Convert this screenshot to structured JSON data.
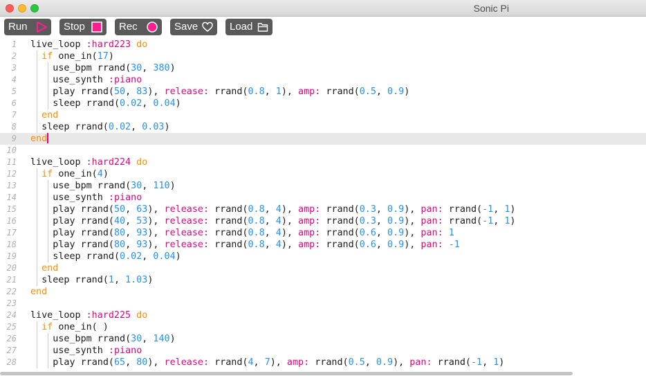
{
  "window": {
    "title": "Sonic Pi"
  },
  "toolbar": {
    "run_label": "Run",
    "stop_label": "Stop",
    "rec_label": "Rec",
    "save_label": "Save",
    "load_label": "Load",
    "icons": {
      "run": "play-triangle-icon",
      "stop": "stop-square-icon",
      "rec": "record-circle-icon",
      "save": "heart-icon",
      "load": "folder-icon"
    },
    "colors": {
      "button_bg": "#5a5a5a",
      "accent": "#ff1e8e"
    }
  },
  "editor": {
    "current_line": 9,
    "lines": [
      {
        "n": "1",
        "indent": 0,
        "tokens": [
          [
            "p",
            "live_loop "
          ],
          [
            "s",
            ":hard223"
          ],
          [
            "k",
            " do"
          ]
        ]
      },
      {
        "n": "2",
        "indent": 1,
        "tokens": [
          [
            "k",
            "if "
          ],
          [
            "p",
            "one_in("
          ],
          [
            "n",
            "17"
          ],
          [
            "p",
            ")"
          ]
        ]
      },
      {
        "n": "3",
        "indent": 2,
        "tokens": [
          [
            "p",
            "use_bpm rrand("
          ],
          [
            "n",
            "30"
          ],
          [
            "p",
            ", "
          ],
          [
            "n",
            "380"
          ],
          [
            "p",
            ")"
          ]
        ]
      },
      {
        "n": "4",
        "indent": 2,
        "tokens": [
          [
            "p",
            "use_synth "
          ],
          [
            "s",
            ":piano"
          ]
        ]
      },
      {
        "n": "5",
        "indent": 2,
        "tokens": [
          [
            "p",
            "play rrand("
          ],
          [
            "n",
            "50"
          ],
          [
            "p",
            ", "
          ],
          [
            "n",
            "83"
          ],
          [
            "p",
            "), "
          ],
          [
            "s",
            "release:"
          ],
          [
            "p",
            " rrand("
          ],
          [
            "n",
            "0.8"
          ],
          [
            "p",
            ", "
          ],
          [
            "n",
            "1"
          ],
          [
            "p",
            "), "
          ],
          [
            "s",
            "amp:"
          ],
          [
            "p",
            " rrand("
          ],
          [
            "n",
            "0.5"
          ],
          [
            "p",
            ", "
          ],
          [
            "n",
            "0.9"
          ],
          [
            "p",
            ")"
          ]
        ]
      },
      {
        "n": "6",
        "indent": 2,
        "tokens": [
          [
            "p",
            "sleep rrand("
          ],
          [
            "n",
            "0.02"
          ],
          [
            "p",
            ", "
          ],
          [
            "n",
            "0.04"
          ],
          [
            "p",
            ")"
          ]
        ]
      },
      {
        "n": "7",
        "indent": 1,
        "tokens": [
          [
            "k",
            "end"
          ]
        ]
      },
      {
        "n": "8",
        "indent": 1,
        "tokens": [
          [
            "p",
            "sleep rrand("
          ],
          [
            "n",
            "0.02"
          ],
          [
            "p",
            ", "
          ],
          [
            "n",
            "0.03"
          ],
          [
            "p",
            ")"
          ]
        ]
      },
      {
        "n": "9",
        "indent": 0,
        "tokens": [
          [
            "k",
            "end"
          ]
        ]
      },
      {
        "n": "10",
        "indent": 0,
        "tokens": []
      },
      {
        "n": "11",
        "indent": 0,
        "tokens": [
          [
            "p",
            "live_loop "
          ],
          [
            "s",
            ":hard224"
          ],
          [
            "k",
            " do"
          ]
        ]
      },
      {
        "n": "12",
        "indent": 1,
        "tokens": [
          [
            "k",
            "if "
          ],
          [
            "p",
            "one_in("
          ],
          [
            "n",
            "4"
          ],
          [
            "p",
            ")"
          ]
        ]
      },
      {
        "n": "13",
        "indent": 2,
        "tokens": [
          [
            "p",
            "use_bpm rrand("
          ],
          [
            "n",
            "30"
          ],
          [
            "p",
            ", "
          ],
          [
            "n",
            "110"
          ],
          [
            "p",
            ")"
          ]
        ]
      },
      {
        "n": "14",
        "indent": 2,
        "tokens": [
          [
            "p",
            "use_synth "
          ],
          [
            "s",
            ":piano"
          ]
        ]
      },
      {
        "n": "15",
        "indent": 2,
        "tokens": [
          [
            "p",
            "play rrand("
          ],
          [
            "n",
            "50"
          ],
          [
            "p",
            ", "
          ],
          [
            "n",
            "63"
          ],
          [
            "p",
            "), "
          ],
          [
            "s",
            "release:"
          ],
          [
            "p",
            " rrand("
          ],
          [
            "n",
            "0.8"
          ],
          [
            "p",
            ", "
          ],
          [
            "n",
            "4"
          ],
          [
            "p",
            "), "
          ],
          [
            "s",
            "amp:"
          ],
          [
            "p",
            " rrand("
          ],
          [
            "n",
            "0.3"
          ],
          [
            "p",
            ", "
          ],
          [
            "n",
            "0.9"
          ],
          [
            "p",
            "), "
          ],
          [
            "s",
            "pan:"
          ],
          [
            "p",
            " rrand("
          ],
          [
            "n",
            "-1"
          ],
          [
            "p",
            ", "
          ],
          [
            "n",
            "1"
          ],
          [
            "p",
            ")"
          ]
        ]
      },
      {
        "n": "16",
        "indent": 2,
        "tokens": [
          [
            "p",
            "play rrand("
          ],
          [
            "n",
            "40"
          ],
          [
            "p",
            ", "
          ],
          [
            "n",
            "53"
          ],
          [
            "p",
            "), "
          ],
          [
            "s",
            "release:"
          ],
          [
            "p",
            " rrand("
          ],
          [
            "n",
            "0.8"
          ],
          [
            "p",
            ", "
          ],
          [
            "n",
            "4"
          ],
          [
            "p",
            "), "
          ],
          [
            "s",
            "amp:"
          ],
          [
            "p",
            " rrand("
          ],
          [
            "n",
            "0.3"
          ],
          [
            "p",
            ", "
          ],
          [
            "n",
            "0.9"
          ],
          [
            "p",
            "), "
          ],
          [
            "s",
            "pan:"
          ],
          [
            "p",
            " rrand("
          ],
          [
            "n",
            "-1"
          ],
          [
            "p",
            ", "
          ],
          [
            "n",
            "1"
          ],
          [
            "p",
            ")"
          ]
        ]
      },
      {
        "n": "17",
        "indent": 2,
        "tokens": [
          [
            "p",
            "play rrand("
          ],
          [
            "n",
            "80"
          ],
          [
            "p",
            ", "
          ],
          [
            "n",
            "93"
          ],
          [
            "p",
            "), "
          ],
          [
            "s",
            "release:"
          ],
          [
            "p",
            " rrand("
          ],
          [
            "n",
            "0.8"
          ],
          [
            "p",
            ", "
          ],
          [
            "n",
            "4"
          ],
          [
            "p",
            "), "
          ],
          [
            "s",
            "amp:"
          ],
          [
            "p",
            " rrand("
          ],
          [
            "n",
            "0.6"
          ],
          [
            "p",
            ", "
          ],
          [
            "n",
            "0.9"
          ],
          [
            "p",
            "), "
          ],
          [
            "s",
            "pan:"
          ],
          [
            "p",
            " "
          ],
          [
            "n",
            "1"
          ]
        ]
      },
      {
        "n": "18",
        "indent": 2,
        "tokens": [
          [
            "p",
            "play rrand("
          ],
          [
            "n",
            "80"
          ],
          [
            "p",
            ", "
          ],
          [
            "n",
            "93"
          ],
          [
            "p",
            "), "
          ],
          [
            "s",
            "release:"
          ],
          [
            "p",
            " rrand("
          ],
          [
            "n",
            "0.8"
          ],
          [
            "p",
            ", "
          ],
          [
            "n",
            "4"
          ],
          [
            "p",
            "), "
          ],
          [
            "s",
            "amp:"
          ],
          [
            "p",
            " rrand("
          ],
          [
            "n",
            "0.6"
          ],
          [
            "p",
            ", "
          ],
          [
            "n",
            "0.9"
          ],
          [
            "p",
            "), "
          ],
          [
            "s",
            "pan:"
          ],
          [
            "p",
            " "
          ],
          [
            "n",
            "-1"
          ]
        ]
      },
      {
        "n": "19",
        "indent": 2,
        "tokens": [
          [
            "p",
            "sleep rrand("
          ],
          [
            "n",
            "0.02"
          ],
          [
            "p",
            ", "
          ],
          [
            "n",
            "0.04"
          ],
          [
            "p",
            ")"
          ]
        ]
      },
      {
        "n": "20",
        "indent": 1,
        "tokens": [
          [
            "k",
            "end"
          ]
        ]
      },
      {
        "n": "21",
        "indent": 1,
        "tokens": [
          [
            "p",
            "sleep rrand("
          ],
          [
            "n",
            "1"
          ],
          [
            "p",
            ", "
          ],
          [
            "n",
            "1.03"
          ],
          [
            "p",
            ")"
          ]
        ]
      },
      {
        "n": "22",
        "indent": 0,
        "tokens": [
          [
            "k",
            "end"
          ]
        ]
      },
      {
        "n": "23",
        "indent": 0,
        "tokens": []
      },
      {
        "n": "24",
        "indent": 0,
        "tokens": [
          [
            "p",
            "live_loop "
          ],
          [
            "s",
            ":hard225"
          ],
          [
            "k",
            " do"
          ]
        ]
      },
      {
        "n": "25",
        "indent": 1,
        "tokens": [
          [
            "k",
            "if "
          ],
          [
            "p",
            "one_in( )"
          ]
        ]
      },
      {
        "n": "26",
        "indent": 2,
        "tokens": [
          [
            "p",
            "use_bpm rrand("
          ],
          [
            "n",
            "30"
          ],
          [
            "p",
            ", "
          ],
          [
            "n",
            "140"
          ],
          [
            "p",
            ")"
          ]
        ]
      },
      {
        "n": "27",
        "indent": 2,
        "tokens": [
          [
            "p",
            "use_synth "
          ],
          [
            "s",
            ":piano"
          ]
        ]
      },
      {
        "n": "28",
        "indent": 2,
        "tokens": [
          [
            "p",
            "play rrand("
          ],
          [
            "n",
            "65"
          ],
          [
            "p",
            ", "
          ],
          [
            "n",
            "80"
          ],
          [
            "p",
            "), "
          ],
          [
            "s",
            "release:"
          ],
          [
            "p",
            " rrand("
          ],
          [
            "n",
            "4"
          ],
          [
            "p",
            ", "
          ],
          [
            "n",
            "7"
          ],
          [
            "p",
            "), "
          ],
          [
            "s",
            "amp:"
          ],
          [
            "p",
            " rrand("
          ],
          [
            "n",
            "0.5"
          ],
          [
            "p",
            ", "
          ],
          [
            "n",
            "0.9"
          ],
          [
            "p",
            "), "
          ],
          [
            "s",
            "pan:"
          ],
          [
            "p",
            " rrand("
          ],
          [
            "n",
            "-1"
          ],
          [
            "p",
            ", "
          ],
          [
            "n",
            "1"
          ],
          [
            "p",
            ")"
          ]
        ]
      }
    ]
  }
}
